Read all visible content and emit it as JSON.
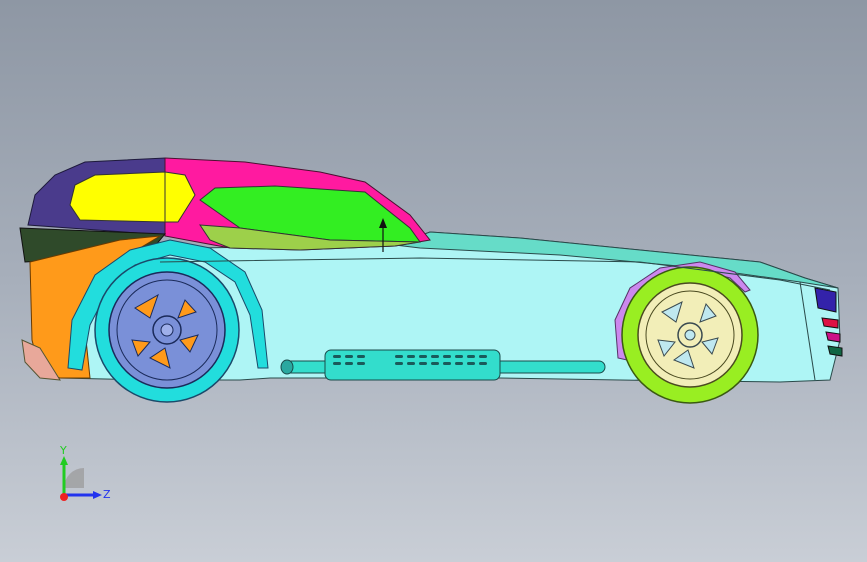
{
  "viewport": {
    "background_top": "#8e97a4",
    "background_bottom": "#c9ced6"
  },
  "model": {
    "type": "sports car 3D model side view",
    "colors": {
      "roof_left": "#4a3b8c",
      "roof_right": "#ff1aa0",
      "rear_window": "#ffff00",
      "side_window": "#33ee22",
      "body": "#aef5f5",
      "front_fender": "#ff9a1a",
      "rear_tire": "#22dddd",
      "rear_rim": "#7a90d8",
      "front_tire": "#99ee22",
      "front_rim": "#f2eeb8",
      "exhaust": "#33ddcc",
      "wheel_arch_trim": "#cc88ee",
      "taillight": "#3322aa"
    }
  },
  "triad": {
    "y_label": "Y",
    "z_label": "Z",
    "y_color": "#22cc22",
    "z_color": "#2233ee",
    "x_color": "#ee2222"
  }
}
